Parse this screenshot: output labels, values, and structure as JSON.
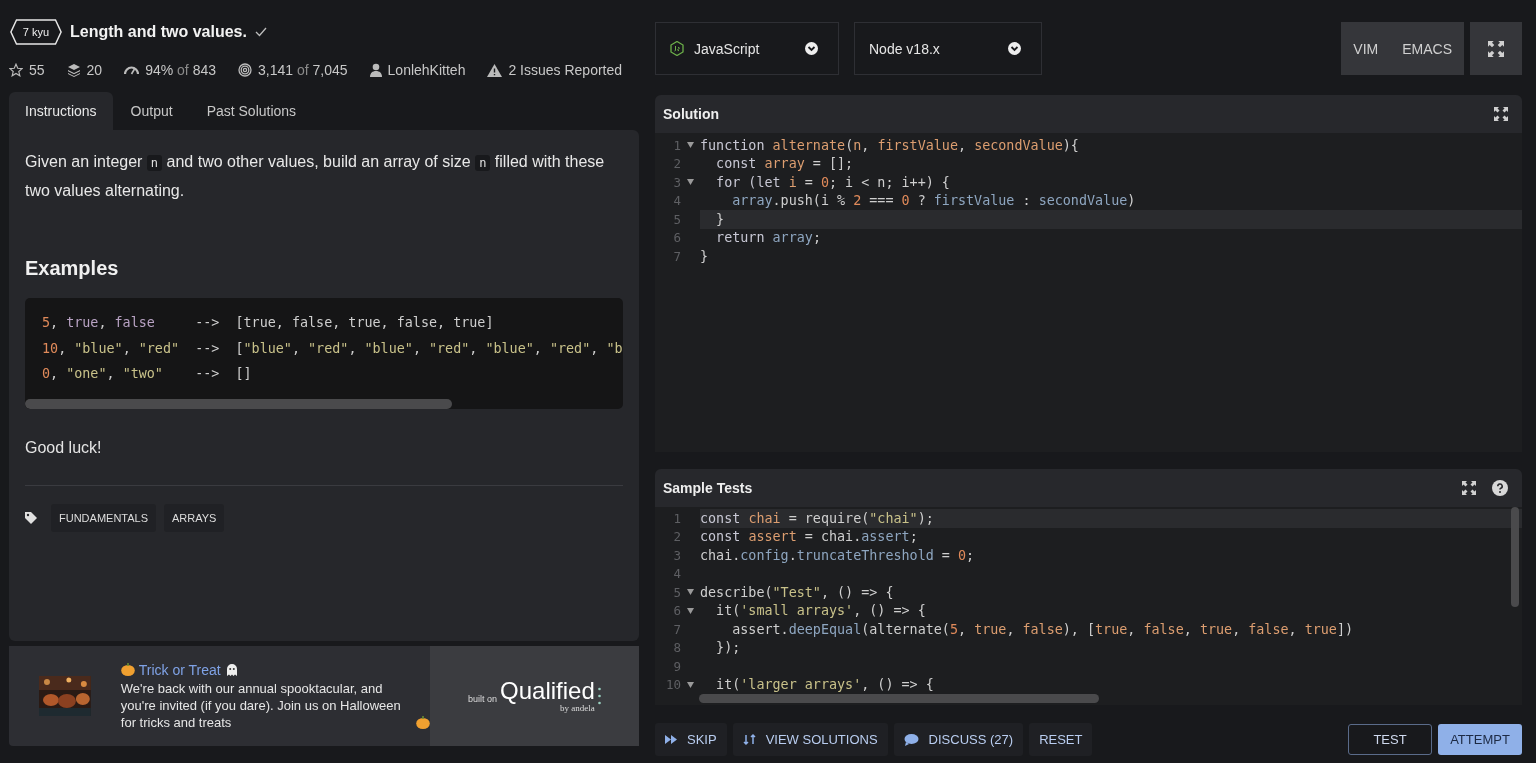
{
  "kata": {
    "rank": "7 kyu",
    "title": "Length and two values.",
    "completed": true
  },
  "stats": [
    {
      "kind": "stars",
      "main": "55"
    },
    {
      "kind": "collections",
      "main": "20"
    },
    {
      "kind": "rating",
      "main": "94%",
      "sep": "of",
      "total": "843"
    },
    {
      "kind": "completions",
      "main": "3,141",
      "sep": "of",
      "total": "7,045"
    },
    {
      "kind": "author",
      "main": "LonlehKitteh"
    },
    {
      "kind": "issues",
      "main": "2 Issues Reported"
    }
  ],
  "tabs": [
    {
      "label": "Instructions",
      "selected": true
    },
    {
      "label": "Output",
      "selected": false
    },
    {
      "label": "Past Solutions",
      "selected": false
    }
  ],
  "description": [
    {
      "text": "Given an integer "
    },
    {
      "code": "n"
    },
    {
      "text": " and two other values, build an array of size "
    },
    {
      "code": "n"
    },
    {
      "text": " filled with these two values alternating."
    }
  ],
  "examples_heading": "Examples",
  "examples": [
    [
      {
        "text": "5",
        "kind": "num"
      },
      {
        "text": ", ",
        "kind": "p"
      },
      {
        "text": "true",
        "kind": "bool"
      },
      {
        "text": ", ",
        "kind": "p"
      },
      {
        "text": "false",
        "kind": "bool"
      },
      {
        "text": "     -->  [true, false, true, false, true]",
        "kind": "p"
      }
    ],
    [
      {
        "text": "10",
        "kind": "num"
      },
      {
        "text": ", ",
        "kind": "p"
      },
      {
        "text": "\"blue\"",
        "kind": "str"
      },
      {
        "text": ", ",
        "kind": "p"
      },
      {
        "text": "\"red\"",
        "kind": "str"
      },
      {
        "text": "  -->  [",
        "kind": "p"
      },
      {
        "text": "\"blue\"",
        "kind": "str"
      },
      {
        "text": ", ",
        "kind": "p"
      },
      {
        "text": "\"red\"",
        "kind": "str"
      },
      {
        "text": ", ",
        "kind": "p"
      },
      {
        "text": "\"blue\"",
        "kind": "str"
      },
      {
        "text": ", ",
        "kind": "p"
      },
      {
        "text": "\"red\"",
        "kind": "str"
      },
      {
        "text": ", ",
        "kind": "p"
      },
      {
        "text": "\"blue\"",
        "kind": "str"
      },
      {
        "text": ", ",
        "kind": "p"
      },
      {
        "text": "\"red\"",
        "kind": "str"
      },
      {
        "text": ", ",
        "kind": "p"
      },
      {
        "text": "\"b",
        "kind": "str"
      }
    ],
    [
      {
        "text": "0",
        "kind": "num"
      },
      {
        "text": ", ",
        "kind": "p"
      },
      {
        "text": "\"one\"",
        "kind": "str"
      },
      {
        "text": ", ",
        "kind": "p"
      },
      {
        "text": "\"two\"",
        "kind": "str"
      },
      {
        "text": "    -->  []",
        "kind": "p"
      }
    ]
  ],
  "closing": "Good luck!",
  "tags": [
    "FUNDAMENTALS",
    "ARRAYS"
  ],
  "ad": {
    "title": "Trick or Treat",
    "text": "We're back with our annual spooktacular, and you're invited (if you dare). Join us on Halloween for tricks and treats",
    "built_on": "built on",
    "brand": "Qualified",
    "by": "by andela"
  },
  "language": "JavaScript",
  "version": "Node v18.x",
  "modes": [
    "VIM",
    "EMACS"
  ],
  "solution": {
    "title": "Solution",
    "lines": [
      {
        "n": "1",
        "fold": true,
        "active": false,
        "tokens": [
          {
            "text": "function ",
            "kind": "kw"
          },
          {
            "text": "alternate",
            "kind": "fn"
          },
          {
            "text": "(",
            "kind": "p"
          },
          {
            "text": "n",
            "kind": "fn"
          },
          {
            "text": ", ",
            "kind": "p"
          },
          {
            "text": "firstValue",
            "kind": "fn"
          },
          {
            "text": ", ",
            "kind": "p"
          },
          {
            "text": "secondValue",
            "kind": "fn"
          },
          {
            "text": "){",
            "kind": "p"
          }
        ]
      },
      {
        "n": "2",
        "fold": false,
        "active": false,
        "tokens": [
          {
            "text": "  const ",
            "kind": "kw"
          },
          {
            "text": "array",
            "kind": "fn"
          },
          {
            "text": " = [];",
            "kind": "p"
          }
        ]
      },
      {
        "n": "3",
        "fold": true,
        "active": false,
        "tokens": [
          {
            "text": "  for (let ",
            "kind": "kw"
          },
          {
            "text": "i",
            "kind": "fn"
          },
          {
            "text": " = ",
            "kind": "p"
          },
          {
            "text": "0",
            "kind": "num"
          },
          {
            "text": "; i < n; i++) {",
            "kind": "p"
          }
        ]
      },
      {
        "n": "4",
        "fold": false,
        "active": false,
        "tokens": [
          {
            "text": "    array",
            "kind": "prop"
          },
          {
            "text": ".push(i % ",
            "kind": "p"
          },
          {
            "text": "2",
            "kind": "num"
          },
          {
            "text": " === ",
            "kind": "p"
          },
          {
            "text": "0",
            "kind": "num"
          },
          {
            "text": " ? ",
            "kind": "p"
          },
          {
            "text": "firstValue",
            "kind": "prop"
          },
          {
            "text": " : ",
            "kind": "p"
          },
          {
            "text": "secondValue",
            "kind": "prop"
          },
          {
            "text": ")",
            "kind": "p"
          }
        ]
      },
      {
        "n": "5",
        "fold": false,
        "active": true,
        "tokens": [
          {
            "text": "  }",
            "kind": "p"
          }
        ]
      },
      {
        "n": "6",
        "fold": false,
        "active": false,
        "tokens": [
          {
            "text": "  return ",
            "kind": "kw"
          },
          {
            "text": "array",
            "kind": "prop"
          },
          {
            "text": ";",
            "kind": "p"
          }
        ]
      },
      {
        "n": "7",
        "fold": false,
        "active": false,
        "tokens": [
          {
            "text": "}",
            "kind": "p"
          }
        ]
      }
    ]
  },
  "tests": {
    "title": "Sample Tests",
    "lines": [
      {
        "n": "1",
        "fold": false,
        "active": true,
        "tokens": [
          {
            "text": "const ",
            "kind": "kw"
          },
          {
            "text": "chai",
            "kind": "fn"
          },
          {
            "text": " = require(",
            "kind": "p"
          },
          {
            "text": "\"chai\"",
            "kind": "str"
          },
          {
            "text": ");",
            "kind": "p"
          }
        ]
      },
      {
        "n": "2",
        "fold": false,
        "active": false,
        "tokens": [
          {
            "text": "const ",
            "kind": "kw"
          },
          {
            "text": "assert",
            "kind": "fn"
          },
          {
            "text": " = chai.",
            "kind": "p"
          },
          {
            "text": "assert",
            "kind": "prop"
          },
          {
            "text": ";",
            "kind": "p"
          }
        ]
      },
      {
        "n": "3",
        "fold": false,
        "active": false,
        "tokens": [
          {
            "text": "chai.",
            "kind": "p"
          },
          {
            "text": "config",
            "kind": "prop"
          },
          {
            "text": ".",
            "kind": "p"
          },
          {
            "text": "truncateThreshold",
            "kind": "prop"
          },
          {
            "text": " = ",
            "kind": "p"
          },
          {
            "text": "0",
            "kind": "num"
          },
          {
            "text": ";",
            "kind": "p"
          }
        ]
      },
      {
        "n": "4",
        "fold": false,
        "active": false
      },
      {
        "n": "5",
        "fold": true,
        "active": false,
        "tokens": [
          {
            "text": "describe(",
            "kind": "p"
          },
          {
            "text": "\"Test\"",
            "kind": "str"
          },
          {
            "text": ", () => {",
            "kind": "p"
          }
        ]
      },
      {
        "n": "6",
        "fold": true,
        "active": false,
        "tokens": [
          {
            "text": "  it(",
            "kind": "p"
          },
          {
            "text": "'small arrays'",
            "kind": "str"
          },
          {
            "text": ", () => {",
            "kind": "p"
          }
        ]
      },
      {
        "n": "7",
        "fold": false,
        "active": false,
        "tokens": [
          {
            "text": "    assert.",
            "kind": "p"
          },
          {
            "text": "deepEqual",
            "kind": "prop"
          },
          {
            "text": "(alternate(",
            "kind": "p"
          },
          {
            "text": "5",
            "kind": "num"
          },
          {
            "text": ", ",
            "kind": "p"
          },
          {
            "text": "true",
            "kind": "fn"
          },
          {
            "text": ", ",
            "kind": "p"
          },
          {
            "text": "false",
            "kind": "fn"
          },
          {
            "text": "), [",
            "kind": "p"
          },
          {
            "text": "true",
            "kind": "fn"
          },
          {
            "text": ", ",
            "kind": "p"
          },
          {
            "text": "false",
            "kind": "fn"
          },
          {
            "text": ", ",
            "kind": "p"
          },
          {
            "text": "true",
            "kind": "fn"
          },
          {
            "text": ", ",
            "kind": "p"
          },
          {
            "text": "false",
            "kind": "fn"
          },
          {
            "text": ", ",
            "kind": "p"
          },
          {
            "text": "true",
            "kind": "fn"
          },
          {
            "text": "])",
            "kind": "p"
          }
        ]
      },
      {
        "n": "8",
        "fold": false,
        "active": false,
        "tokens": [
          {
            "text": "  });",
            "kind": "p"
          }
        ]
      },
      {
        "n": "9",
        "fold": false,
        "active": false
      },
      {
        "n": "10",
        "fold": true,
        "active": false,
        "tokens": [
          {
            "text": "  it(",
            "kind": "p"
          },
          {
            "text": "'larger arrays'",
            "kind": "str"
          },
          {
            "text": ", () => {",
            "kind": "p"
          }
        ]
      }
    ]
  },
  "actions": [
    {
      "kind": "skip",
      "label": "SKIP"
    },
    {
      "kind": "solutions",
      "label": "VIEW SOLUTIONS"
    },
    {
      "kind": "discuss",
      "label": "DISCUSS (27)"
    },
    {
      "kind": "reset",
      "label": "RESET"
    }
  ],
  "run_buttons": [
    {
      "kind": "outline",
      "label": "TEST"
    },
    {
      "kind": "primary",
      "label": "ATTEMPT"
    }
  ]
}
